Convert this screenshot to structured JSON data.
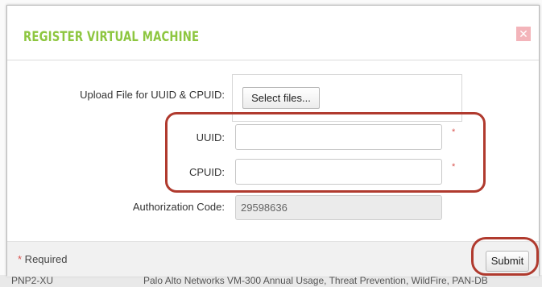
{
  "background_row": {
    "col1": "PNP2-XU",
    "col2": "Palo Alto Networks VM-300 Annual Usage, Threat Prevention, WildFire, PAN-DB"
  },
  "modal": {
    "title": "REGISTER VIRTUAL MACHINE",
    "close_glyph": "✕",
    "upload": {
      "label": "Upload File for UUID & CPUID:",
      "button_label": "Select files..."
    },
    "uuid": {
      "label": "UUID:",
      "value": "",
      "required_mark": "*"
    },
    "cpuid": {
      "label": "CPUID:",
      "value": "",
      "required_mark": "*"
    },
    "auth_code": {
      "label": "Authorization Code:",
      "value": "29598636"
    },
    "footer": {
      "required_star": "*",
      "required_text": " Required",
      "submit_label": "Submit"
    }
  },
  "colors": {
    "title": "#8dc63f",
    "close_bg": "#f3b4ba",
    "required_star": "#d9534f",
    "annotation": "#b03a2e"
  },
  "icons": {
    "close": "close-icon"
  }
}
